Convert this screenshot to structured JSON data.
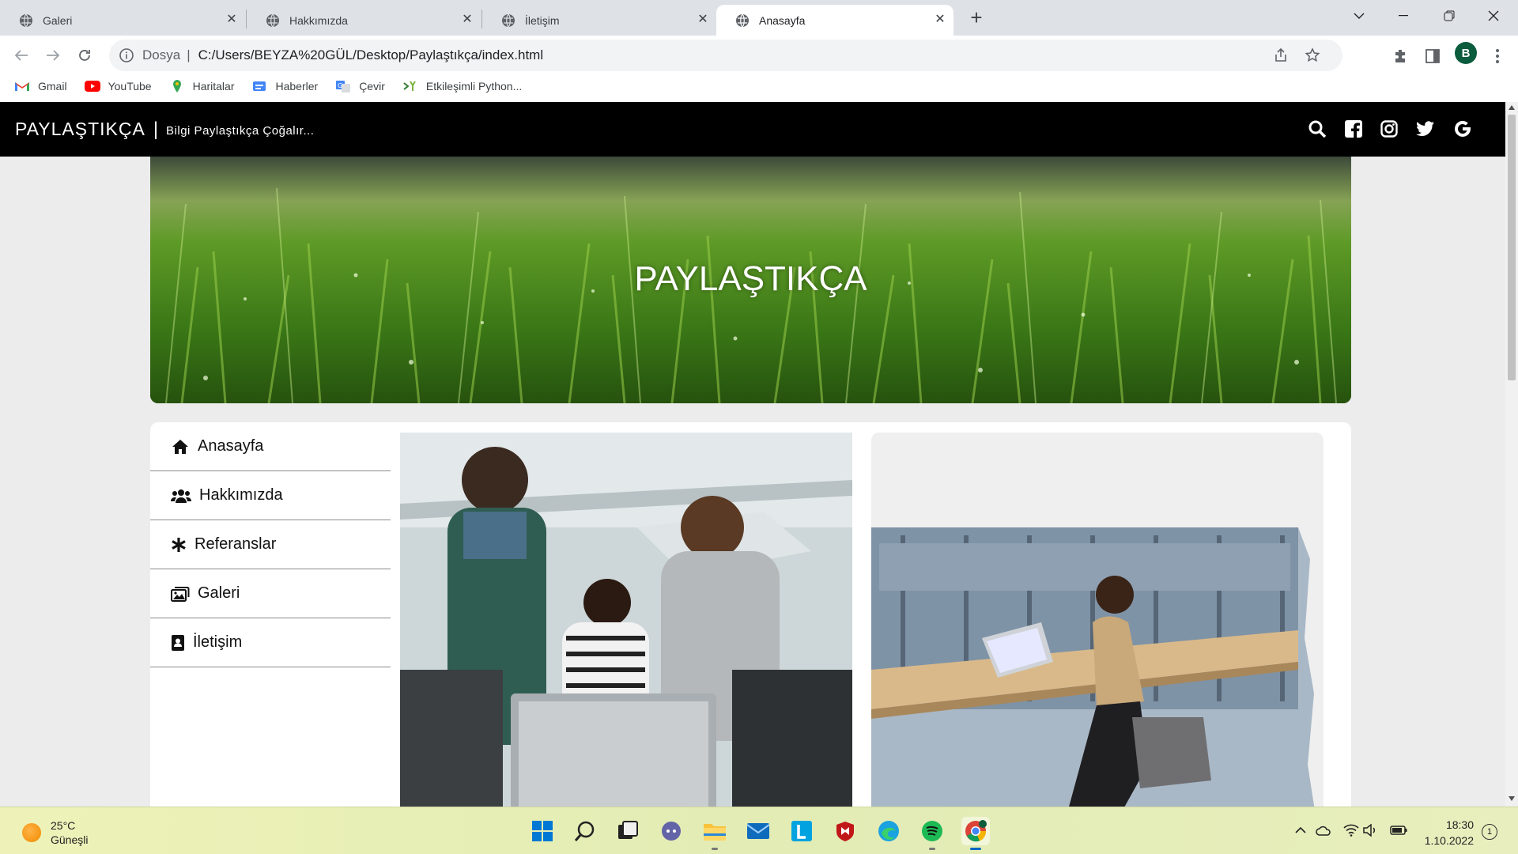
{
  "browser": {
    "tabs": [
      {
        "title": "Galeri",
        "active": false
      },
      {
        "title": "Hakkımızda",
        "active": false
      },
      {
        "title": "İletişim",
        "active": false
      },
      {
        "title": "Anasayfa",
        "active": true
      }
    ],
    "address": {
      "scheme_label": "Dosya",
      "url": "C:/Users/BEYZA%20GÜL/Desktop/Paylaştıkça/index.html"
    },
    "profile_initial": "B",
    "bookmarks": [
      "Gmail",
      "YouTube",
      "Haritalar",
      "Haberler",
      "Çevir",
      "Etkileşimli Python..."
    ]
  },
  "site": {
    "brand": "PAYLAŞTIKÇA",
    "separator": "|",
    "tagline": "Bilgi Paylaştıkça Çoğalır...",
    "social": [
      "search-icon",
      "facebook-icon",
      "instagram-icon",
      "twitter-icon",
      "google-icon"
    ],
    "hero_title": "PAYLAŞTIKÇA",
    "menu": [
      {
        "label": "Anasayfa",
        "icon": "home-icon"
      },
      {
        "label": "Hakkımızda",
        "icon": "users-icon"
      },
      {
        "label": "Referanslar",
        "icon": "asterisk-icon"
      },
      {
        "label": "Galeri",
        "icon": "images-icon"
      },
      {
        "label": "İletişim",
        "icon": "contact-card-icon"
      }
    ]
  },
  "taskbar": {
    "weather": {
      "temp": "25°C",
      "condition": "Güneşli"
    },
    "time": "18:30",
    "date": "1.10.2022",
    "notifications": "1"
  },
  "colors": {
    "site_header": "#000000",
    "page_bg": "#ececec",
    "accent_green": "#4e8a1f"
  }
}
